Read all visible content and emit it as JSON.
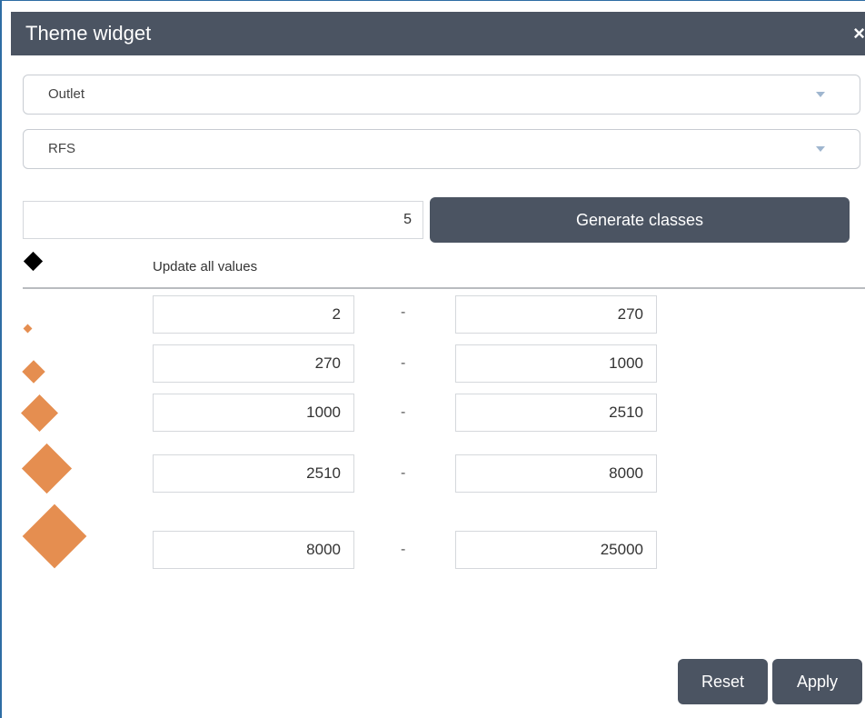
{
  "window": {
    "title": "Theme widget",
    "close_glyph": "×"
  },
  "selects": {
    "layer": "Outlet",
    "field": "RFS"
  },
  "classes": {
    "count": "5",
    "generate_label": "Generate classes",
    "update_all_label": "Update all values",
    "separator": "-",
    "rows": [
      {
        "min": "2",
        "max": "270"
      },
      {
        "min": "270",
        "max": "1000"
      },
      {
        "min": "1000",
        "max": "2510"
      },
      {
        "min": "2510",
        "max": "8000"
      },
      {
        "min": "8000",
        "max": "25000"
      }
    ]
  },
  "buttons": {
    "reset": "Reset",
    "apply": "Apply"
  },
  "colors": {
    "titlebar": "#4b5462",
    "symbol": "#e58e50",
    "symbol_header": "#000000"
  }
}
